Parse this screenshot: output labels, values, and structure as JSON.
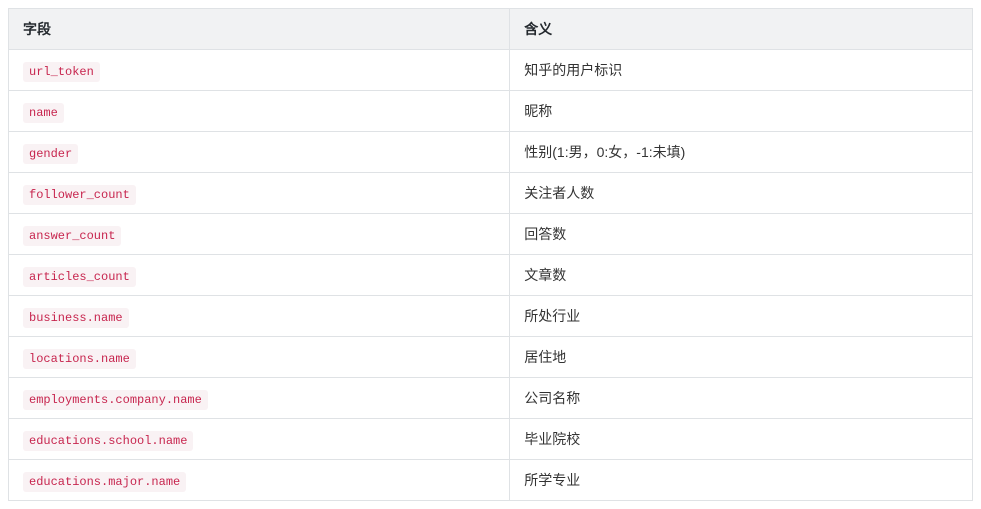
{
  "headers": {
    "field": "字段",
    "meaning": "含义"
  },
  "rows": [
    {
      "field": "url_token",
      "meaning": "知乎的用户标识"
    },
    {
      "field": "name",
      "meaning": "昵称"
    },
    {
      "field": "gender",
      "meaning": "性别(1:男，0:女，-1:未填)"
    },
    {
      "field": "follower_count",
      "meaning": "关注者人数"
    },
    {
      "field": "answer_count",
      "meaning": "回答数"
    },
    {
      "field": "articles_count",
      "meaning": "文章数"
    },
    {
      "field": "business.name",
      "meaning": "所处行业"
    },
    {
      "field": "locations.name",
      "meaning": "居住地"
    },
    {
      "field": "employments.company.name",
      "meaning": "公司名称"
    },
    {
      "field": "educations.school.name",
      "meaning": "毕业院校"
    },
    {
      "field": "educations.major.name",
      "meaning": "所学专业"
    }
  ]
}
